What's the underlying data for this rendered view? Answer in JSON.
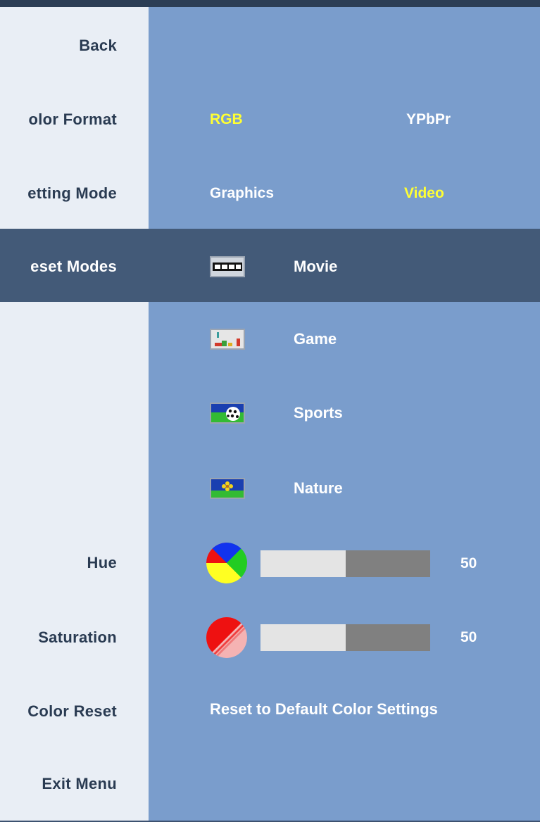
{
  "menu": {
    "items": [
      {
        "label": "Back"
      },
      {
        "label": "olor Format"
      },
      {
        "label": "etting Mode"
      },
      {
        "label": "eset Modes"
      },
      {
        "label": "Hue"
      },
      {
        "label": "Saturation"
      },
      {
        "label": "Color Reset"
      },
      {
        "label": "Exit Menu"
      }
    ]
  },
  "color_format": {
    "options": [
      "RGB",
      "YPbPr"
    ],
    "selected": "RGB"
  },
  "setting_mode": {
    "options": [
      "Graphics",
      "Video"
    ],
    "selected": "Video"
  },
  "preset_modes": [
    {
      "label": "Movie",
      "icon": "movie-icon",
      "selected": true
    },
    {
      "label": "Game",
      "icon": "game-icon",
      "selected": false
    },
    {
      "label": "Sports",
      "icon": "sports-icon",
      "selected": false
    },
    {
      "label": "Nature",
      "icon": "nature-icon",
      "selected": false
    }
  ],
  "hue": {
    "value": "50",
    "level": 0.5,
    "icon": "hue-color-wheel-icon"
  },
  "saturation": {
    "value": "50",
    "level": 0.5,
    "icon": "saturation-icon"
  },
  "color_reset": {
    "label": "Reset to Default Color Settings"
  },
  "colors": {
    "panel_bg": "#7a9dcc",
    "left_bg": "#e9eef5",
    "highlight_row": "#435a78",
    "selected_option": "#ffff33",
    "label_text": "#2a3b52"
  }
}
